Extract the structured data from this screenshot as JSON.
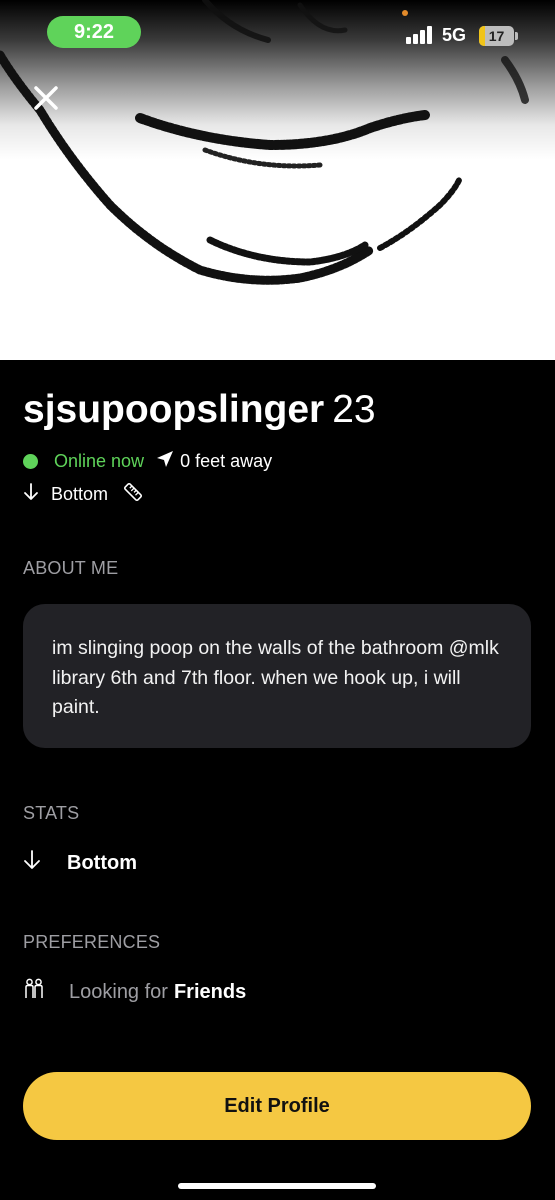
{
  "status_bar": {
    "time": "9:22",
    "network": "5G",
    "battery": "17",
    "battery_level": 0.17
  },
  "profile": {
    "username": "sjsupoopslinger",
    "age": "23",
    "online_status": "Online now",
    "distance": "0 feet away",
    "position": "Bottom"
  },
  "about": {
    "heading": "ABOUT ME",
    "text": "im slinging poop on the walls of the bathroom @mlk library 6th and 7th floor. when we hook up, i will paint."
  },
  "stats": {
    "heading": "STATS",
    "position": "Bottom"
  },
  "preferences": {
    "heading": "PREFERENCES",
    "looking_for_prefix": "Looking for",
    "looking_for_value": "Friends"
  },
  "actions": {
    "edit_profile": "Edit Profile"
  },
  "icons": {
    "close": "close-icon",
    "location": "location-arrow-icon",
    "down_arrow": "arrow-down-icon",
    "ruler": "ruler-icon",
    "people": "people-icon"
  },
  "colors": {
    "online": "#5fd35a",
    "accent": "#f5c842",
    "background": "#000000",
    "card": "#222226",
    "muted": "#9e9ea3"
  }
}
